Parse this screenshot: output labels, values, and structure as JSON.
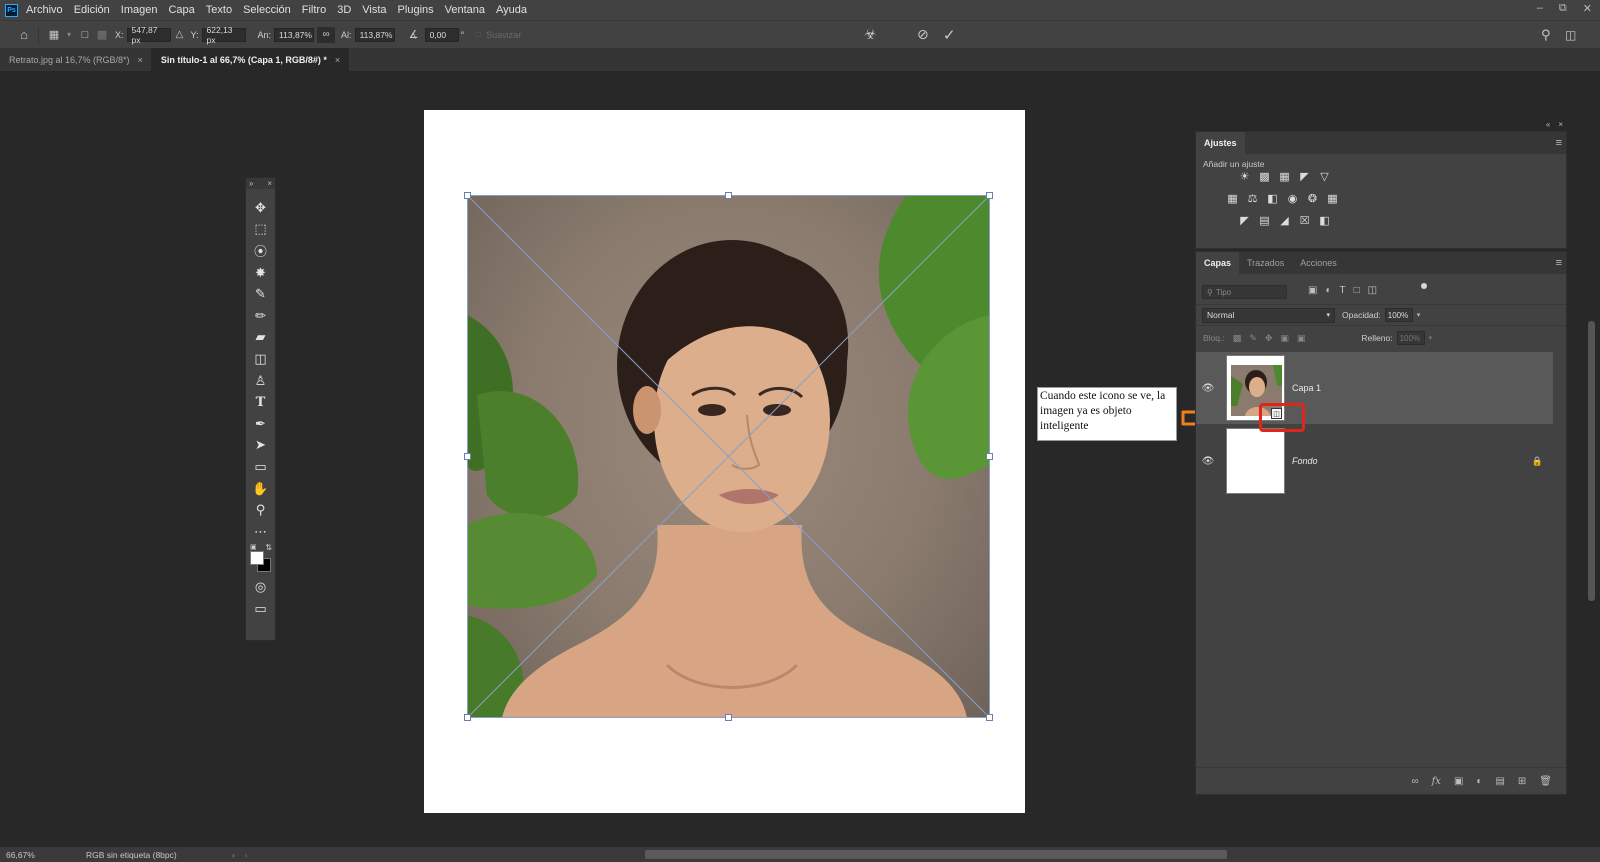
{
  "app": {
    "logo": "Ps"
  },
  "menu": [
    "Archivo",
    "Edición",
    "Imagen",
    "Capa",
    "Texto",
    "Selección",
    "Filtro",
    "3D",
    "Vista",
    "Plugins",
    "Ventana",
    "Ayuda"
  ],
  "options": {
    "x_label": "X:",
    "x_value": "547,87 px",
    "y_label": "Y:",
    "y_value": "622,13 px",
    "w_label": "An:",
    "w_value": "113,87%",
    "h_label": "Al:",
    "h_value": "113,87%",
    "angle_value": "0,00",
    "angle_unit": "°",
    "smooth_label": "Suavizar"
  },
  "tabs": [
    {
      "label": "Retrato.jpg al 16,7% (RGB/8*)",
      "close": "×"
    },
    {
      "label": "Sin título-1 al 66,7% (Capa 1, RGB/8#) *",
      "close": "×"
    }
  ],
  "callout": {
    "text": "Cuando este icono se ve, la imagen ya es objeto inteligente"
  },
  "adjustments": {
    "tab": "Ajustes",
    "subtitle": "Añadir un ajuste"
  },
  "layers_panel": {
    "tabs": [
      "Capas",
      "Trazados",
      "Acciones"
    ],
    "filter_placeholder": "Tipo",
    "blend_mode": "Normal",
    "opacity_label": "Opacidad:",
    "opacity_value": "100%",
    "lock_label": "Bloq.:",
    "fill_label": "Relleno:",
    "fill_value": "100%",
    "layers": [
      {
        "name": "Capa 1",
        "selected": true,
        "smart_object": true
      },
      {
        "name": "Fondo",
        "selected": false,
        "locked": true
      }
    ]
  },
  "status": {
    "zoom": "66,67%",
    "doc_info": "RGB sin etiqueta (8bpc)"
  },
  "colors": {
    "accent": "#31a8ff",
    "highlight_red": "#e0261b",
    "arrow_orange": "#f07f1e"
  }
}
